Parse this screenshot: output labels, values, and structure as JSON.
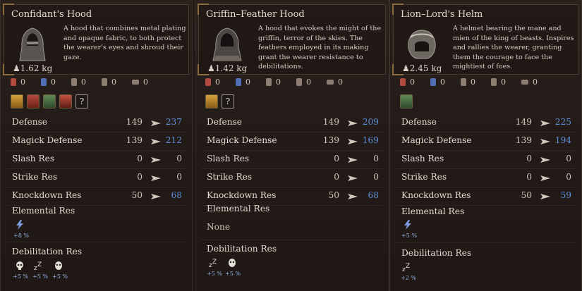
{
  "items": [
    {
      "name": "Confidant's Hood",
      "weight": "1.62 kg",
      "description": "A hood that combines metal plating and opaque fabric, to both protect the wearer's eyes and shroud their gaze.",
      "resistances": [
        "0",
        "0",
        "0",
        "0",
        "0"
      ],
      "stats": [
        {
          "label": "Defense",
          "old": "149",
          "new": "237",
          "up": true
        },
        {
          "label": "Magick Defense",
          "old": "139",
          "new": "212",
          "up": true
        },
        {
          "label": "Slash Res",
          "old": "0",
          "new": "0",
          "up": false
        },
        {
          "label": "Strike Res",
          "old": "0",
          "new": "0",
          "up": false
        },
        {
          "label": "Knockdown Res",
          "old": "50",
          "new": "68",
          "up": true
        }
      ],
      "elemental_label": "Elemental Res",
      "elemental_value": "+8 %",
      "debilitation_label": "Debilitation Res",
      "debilitations": [
        "+5 %",
        "+5 %",
        "+5 %"
      ]
    },
    {
      "name": "Griffin–Feather Hood",
      "weight": "1.42 kg",
      "description": "A hood that evokes the might of the griffin, terror of the skies. The feathers employed in its making grant the wearer resistance to debilitations.",
      "resistances": [
        "0",
        "0",
        "0",
        "0",
        "0"
      ],
      "stats": [
        {
          "label": "Defense",
          "old": "149",
          "new": "209",
          "up": true
        },
        {
          "label": "Magick Defense",
          "old": "139",
          "new": "169",
          "up": true
        },
        {
          "label": "Slash Res",
          "old": "0",
          "new": "0",
          "up": false
        },
        {
          "label": "Strike Res",
          "old": "0",
          "new": "0",
          "up": false
        },
        {
          "label": "Knockdown Res",
          "old": "50",
          "new": "68",
          "up": true
        }
      ],
      "elemental_label": "Elemental Res",
      "elemental_none": "None",
      "debilitation_label": "Debilitation Res",
      "debilitations": [
        "+5 %",
        "+5 %"
      ]
    },
    {
      "name": "Lion–Lord's Helm",
      "weight": "2.45 kg",
      "description": "A helmet bearing the mane and mien of the king of beasts. Inspires and rallies the wearer, granting them the courage to face the mightiest of foes.",
      "resistances": [
        "0",
        "0",
        "0",
        "0",
        "0"
      ],
      "stats": [
        {
          "label": "Defense",
          "old": "149",
          "new": "225",
          "up": true
        },
        {
          "label": "Magick Defense",
          "old": "139",
          "new": "194",
          "up": true
        },
        {
          "label": "Slash Res",
          "old": "0",
          "new": "0",
          "up": false
        },
        {
          "label": "Strike Res",
          "old": "0",
          "new": "0",
          "up": false
        },
        {
          "label": "Knockdown Res",
          "old": "50",
          "new": "59",
          "up": true
        }
      ],
      "elemental_label": "Elemental Res",
      "elemental_value": "+5 %",
      "debilitation_label": "Debilitation Res",
      "debilitations": [
        "+2 %"
      ]
    }
  ],
  "icons": {
    "weight": "weight-icon",
    "resistance": [
      "red-ward-icon",
      "blue-ward-icon",
      "claw-ward-icon",
      "fist-ward-icon",
      "chest-ward-icon"
    ],
    "badge_question": "?",
    "arrow": "arrow-right-icon",
    "lightning": "lightning-icon",
    "debilitation_c1": [
      "skull-icon",
      "sleep-icon",
      "mask-icon"
    ],
    "debilitation_c2": [
      "sleep-icon",
      "mask-icon"
    ],
    "debilitation_c3": [
      "sleep-icon"
    ]
  },
  "colors": {
    "stat_up": "#5d8ed8",
    "text": "#e2dace",
    "panel_border": "#8a6b3c"
  }
}
